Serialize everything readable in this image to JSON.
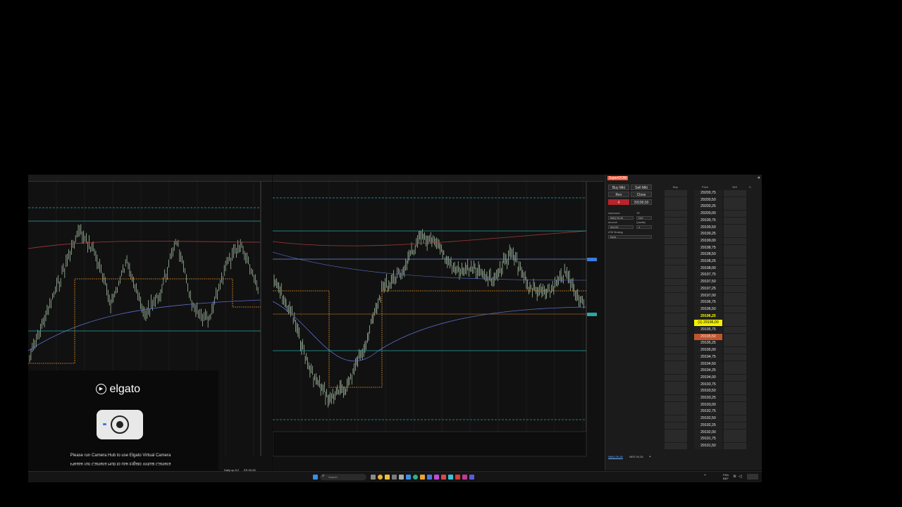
{
  "dom": {
    "title": "SuperDOM",
    "buttons": {
      "buy_mkt": "Buy Mkt",
      "sell_mkt": "Sell Mkt",
      "rev": "Rev",
      "close": "Close"
    },
    "position_qty": "4",
    "position_price": "29199,50",
    "fields": {
      "instrument_label": "Instrument",
      "instrument_value": "NMQ 09-26",
      "tif_label": "TIF",
      "tif_value": "DAY",
      "account_label": "Account",
      "account_value": "Sim101",
      "quantity_label": "Quantity",
      "quantity_value": "4",
      "atm_label": "ATM Strategy",
      "atm_value": "None"
    },
    "columns": {
      "buy": "Buy",
      "price": "Price",
      "sell": "Sell",
      "c": "C"
    },
    "prices": [
      "29200,75",
      "29200,50",
      "29200,25",
      "29200,00",
      "29199,75",
      "29199,50",
      "29199,25",
      "29199,00",
      "29198,75",
      "29198,50",
      "29198,25",
      "29198,00",
      "29197,75",
      "29197,50",
      "29197,25",
      "29197,00",
      "29196,75",
      "29196,50",
      "29196,25",
      "(1) 29196,00",
      "29195,75",
      "29195,50",
      "29195,25",
      "29195,00",
      "29194,75",
      "29194,50",
      "29194,25",
      "29194,00",
      "29193,75",
      "29193,50",
      "29193,25",
      "29193,00",
      "29192,75",
      "29192,50",
      "29192,25",
      "29192,00",
      "29191,75",
      "29191,50"
    ],
    "last_price_index": 18,
    "position_row_index": 19,
    "ask_row_index": 21,
    "bid_row_index": 20,
    "buy_size": "4",
    "sell_size": "1",
    "tabs": [
      "NMQ 09-26",
      "NES 09-26"
    ]
  },
  "elgato": {
    "logo": "elgato",
    "message": "Please run Camera Hub to use Elgato Virtual Camera",
    "message_mirrored": "Please run Camera Hub to use Elgato Virtual Camera"
  },
  "taskbar": {
    "search_placeholder": "Search",
    "tabs": [
      "Daily op 6.2",
      "ES 09-26"
    ],
    "lang": "FRA",
    "region": "BEF"
  },
  "colors": {
    "dom_title": "#ff5a3c",
    "last_price": "#ffff00",
    "position_row": "#f2f000",
    "ask_row": "#c0552d",
    "bid_cell": "#4a86d8",
    "candle_up": "#d0f0d0",
    "vwap_orange": "#d98a2b",
    "ma_blue": "#5a6ec8",
    "ma_red": "#a33a3a",
    "level_teal": "#2aa6a6"
  }
}
